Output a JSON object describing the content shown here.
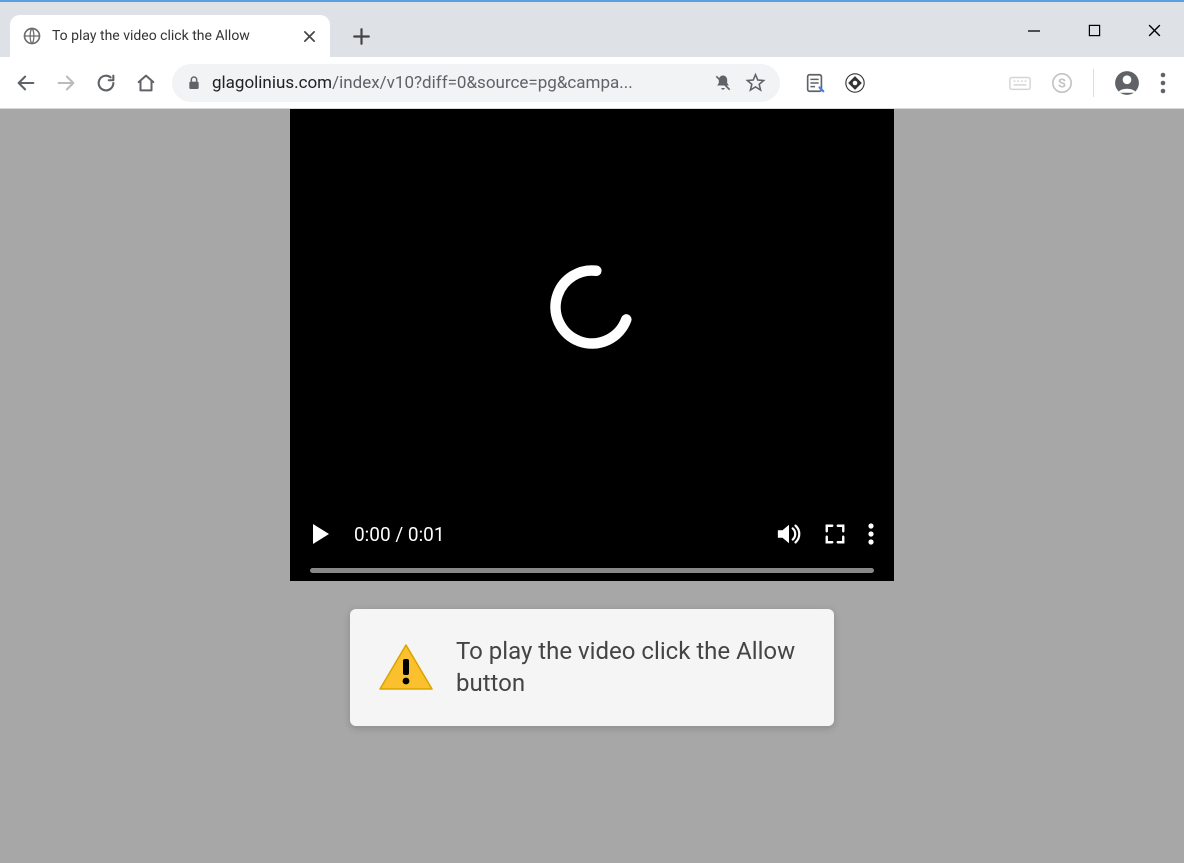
{
  "window": {
    "tab_title": "To play the video click the Allow"
  },
  "address": {
    "domain": "glagolinius.com",
    "path": "/index/v10?diff=0&source=pg&campa..."
  },
  "video": {
    "current_time": "0:00",
    "total_time": "0:01"
  },
  "prompt": {
    "message": "To play the video click the Allow button"
  }
}
